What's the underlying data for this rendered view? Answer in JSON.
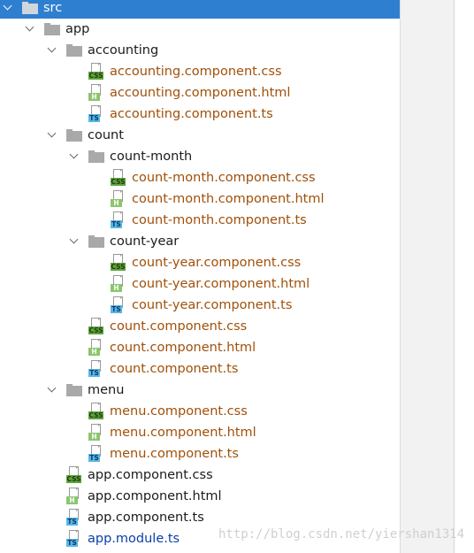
{
  "tree": {
    "rows": [
      {
        "label": "src",
        "kind": "folder",
        "depth": 0,
        "selected": true,
        "color": "dark"
      },
      {
        "label": "app",
        "kind": "folder",
        "depth": 1,
        "color": "dark"
      },
      {
        "label": "accounting",
        "kind": "folder",
        "depth": 2,
        "color": "dark"
      },
      {
        "label": "accounting.component.css",
        "kind": "file",
        "file_type": "css",
        "depth": 3,
        "color": "mod"
      },
      {
        "label": "accounting.component.html",
        "kind": "file",
        "file_type": "html",
        "depth": 3,
        "color": "mod"
      },
      {
        "label": "accounting.component.ts",
        "kind": "file",
        "file_type": "ts",
        "depth": 3,
        "color": "mod"
      },
      {
        "label": "count",
        "kind": "folder",
        "depth": 2,
        "color": "dark"
      },
      {
        "label": "count-month",
        "kind": "folder",
        "depth": 3,
        "color": "dark"
      },
      {
        "label": "count-month.component.css",
        "kind": "file",
        "file_type": "css",
        "depth": 4,
        "color": "mod"
      },
      {
        "label": "count-month.component.html",
        "kind": "file",
        "file_type": "html",
        "depth": 4,
        "color": "mod"
      },
      {
        "label": "count-month.component.ts",
        "kind": "file",
        "file_type": "ts",
        "depth": 4,
        "color": "mod"
      },
      {
        "label": "count-year",
        "kind": "folder",
        "depth": 3,
        "color": "dark"
      },
      {
        "label": "count-year.component.css",
        "kind": "file",
        "file_type": "css",
        "depth": 4,
        "color": "mod"
      },
      {
        "label": "count-year.component.html",
        "kind": "file",
        "file_type": "html",
        "depth": 4,
        "color": "mod"
      },
      {
        "label": "count-year.component.ts",
        "kind": "file",
        "file_type": "ts",
        "depth": 4,
        "color": "mod"
      },
      {
        "label": "count.component.css",
        "kind": "file",
        "file_type": "css",
        "depth": 3,
        "color": "mod"
      },
      {
        "label": "count.component.html",
        "kind": "file",
        "file_type": "html",
        "depth": 3,
        "color": "mod"
      },
      {
        "label": "count.component.ts",
        "kind": "file",
        "file_type": "ts",
        "depth": 3,
        "color": "mod"
      },
      {
        "label": "menu",
        "kind": "folder",
        "depth": 2,
        "color": "dark"
      },
      {
        "label": "menu.component.css",
        "kind": "file",
        "file_type": "css",
        "depth": 3,
        "color": "mod"
      },
      {
        "label": "menu.component.html",
        "kind": "file",
        "file_type": "html",
        "depth": 3,
        "color": "mod"
      },
      {
        "label": "menu.component.ts",
        "kind": "file",
        "file_type": "ts",
        "depth": 3,
        "color": "mod"
      },
      {
        "label": "app.component.css",
        "kind": "file",
        "file_type": "css",
        "depth": 2,
        "color": "dark"
      },
      {
        "label": "app.component.html",
        "kind": "file",
        "file_type": "html",
        "depth": 2,
        "color": "dark"
      },
      {
        "label": "app.component.ts",
        "kind": "file",
        "file_type": "ts",
        "depth": 2,
        "color": "dark"
      },
      {
        "label": "app.module.ts",
        "kind": "file",
        "file_type": "ts",
        "depth": 2,
        "color": "added"
      }
    ]
  },
  "badges": {
    "css": "CSS",
    "html": "H",
    "ts": "TS"
  },
  "colors": {
    "selection": "#2f7fd0",
    "modified_file": "#a0500a",
    "added_file": "#0b3fa8",
    "default_text": "#1b1b1b"
  },
  "watermark": "http://blog.csdn.net/yiershan1314"
}
